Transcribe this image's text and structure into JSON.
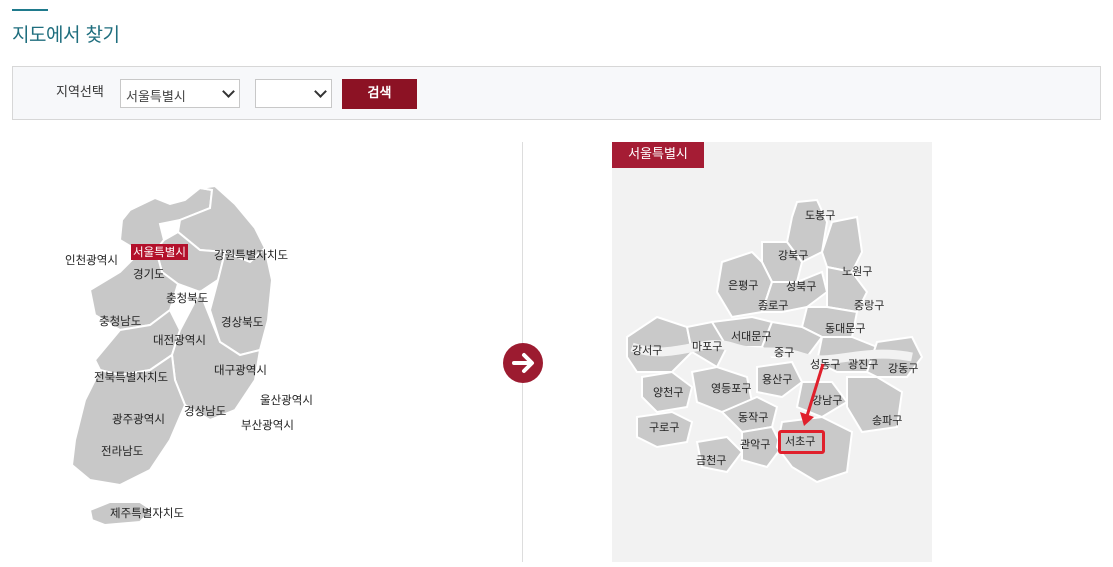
{
  "page": {
    "title": "지도에서 찾기"
  },
  "search": {
    "label": "지역선택",
    "region_select": "서울특별시",
    "district_select": "",
    "button": "검색"
  },
  "korea_map": {
    "regions": [
      "인천광역시",
      "서울특별시",
      "강원특별자치도",
      "경기도",
      "충청북도",
      "충청남도",
      "경상북도",
      "대전광역시",
      "대구광역시",
      "전북특별자치도",
      "울산광역시",
      "광주광역시",
      "경상남도",
      "부산광역시",
      "전라남도",
      "제주특별자치도"
    ],
    "selected": "서울특별시"
  },
  "seoul_panel": {
    "title": "서울특별시",
    "districts": [
      "도봉구",
      "강북구",
      "노원구",
      "은평구",
      "성북구",
      "중랑구",
      "종로구",
      "서대문구",
      "동대문구",
      "강서구",
      "마포구",
      "중구",
      "성동구",
      "광진구",
      "강동구",
      "양천구",
      "영등포구",
      "용산구",
      "강남구",
      "송파구",
      "구로구",
      "동작구",
      "관악구",
      "서초구",
      "금천구"
    ],
    "highlighted": "서초구"
  },
  "colors": {
    "accent": "#a51c34",
    "title": "#1f6e7e",
    "map_fill": "#c8c8c8"
  }
}
